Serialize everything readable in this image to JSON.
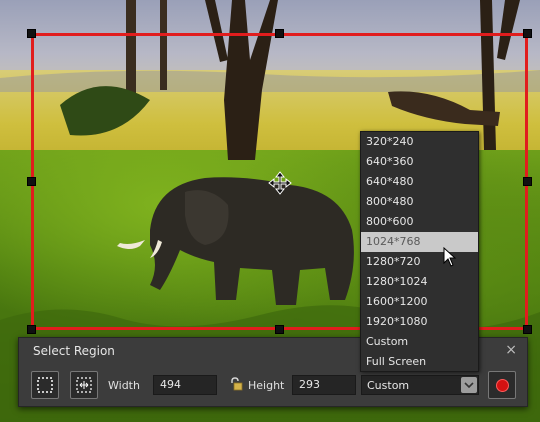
{
  "panel": {
    "title": "Select Region",
    "close_glyph": "×",
    "width_label": "Width",
    "width_value": "494",
    "height_label": "Height",
    "height_value": "293",
    "preset_selected": "Custom"
  },
  "dropdown": {
    "items": [
      "320*240",
      "640*360",
      "640*480",
      "800*480",
      "800*600",
      "1024*768",
      "1280*720",
      "1280*1024",
      "1600*1200",
      "1920*1080",
      "Custom",
      "Full Screen"
    ],
    "highlighted_index": 5
  },
  "icons": {
    "region_tool": "select-region-icon",
    "fullscreen_tool": "fullscreen-region-icon",
    "lock": "lock-icon",
    "move": "move-icon",
    "record": "record-icon"
  },
  "colors": {
    "selection_border": "#e11d1d",
    "record": "#d41212",
    "panel_bg": "#3c3c3c",
    "dropdown_highlight": "#c9c9c9"
  }
}
